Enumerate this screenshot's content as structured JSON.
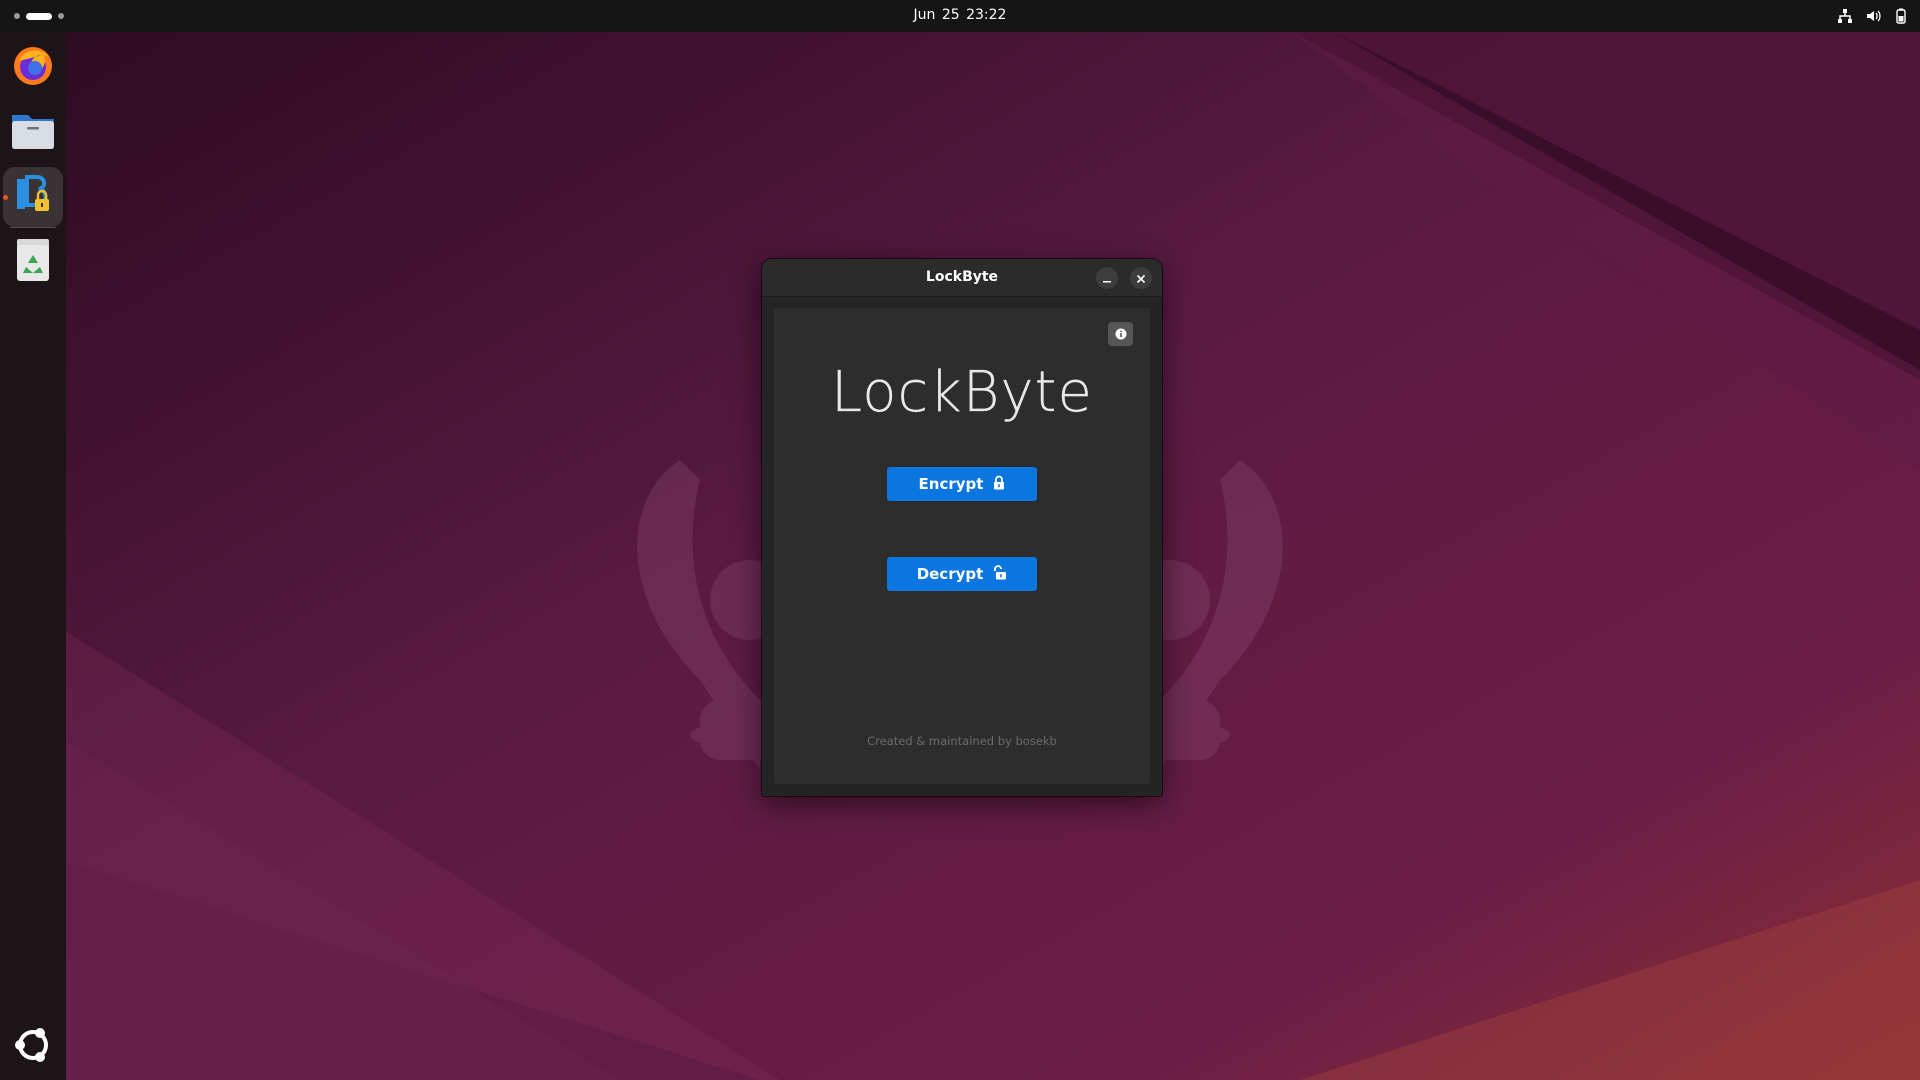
{
  "topbar": {
    "clock": "Jun 25  23:22",
    "tray_icons": [
      "network-icon",
      "volume-icon",
      "battery-icon"
    ]
  },
  "dock": {
    "apps": [
      "Firefox",
      "Files",
      "LockByte",
      "Trash",
      "Show Apps"
    ]
  },
  "window": {
    "title": "LockByte",
    "heading": "LockByte",
    "encrypt_label": "Encrypt",
    "decrypt_label": "Decrypt",
    "footer": "Created & maintained by bosekb",
    "accent_color": "#0b76e0"
  }
}
